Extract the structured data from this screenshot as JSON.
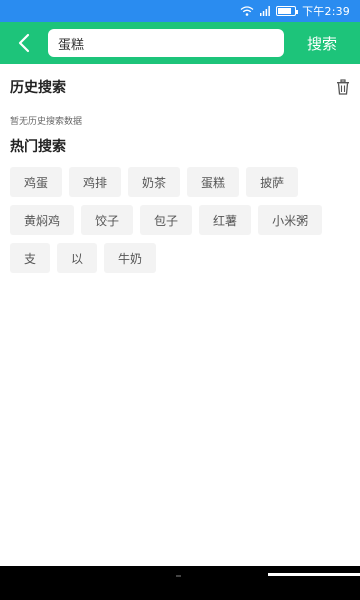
{
  "status_bar": {
    "time": "下午2:39",
    "icons": [
      "wifi-icon",
      "signal-icon",
      "battery-icon"
    ],
    "color": "#2a8cf0"
  },
  "header": {
    "back_icon": "chevron-left-icon",
    "search_value": "蛋糕",
    "search_button": "搜索",
    "color": "#1dc47a"
  },
  "history": {
    "title": "历史搜索",
    "empty_text": "暂无历史搜索数据",
    "delete_icon": "trash-icon"
  },
  "hot": {
    "title": "热门搜索",
    "items": [
      "鸡蛋",
      "鸡排",
      "奶茶",
      "蛋糕",
      "披萨",
      "黄焖鸡",
      "饺子",
      "包子",
      "红薯",
      "小米粥",
      "支",
      "以",
      "牛奶"
    ]
  }
}
